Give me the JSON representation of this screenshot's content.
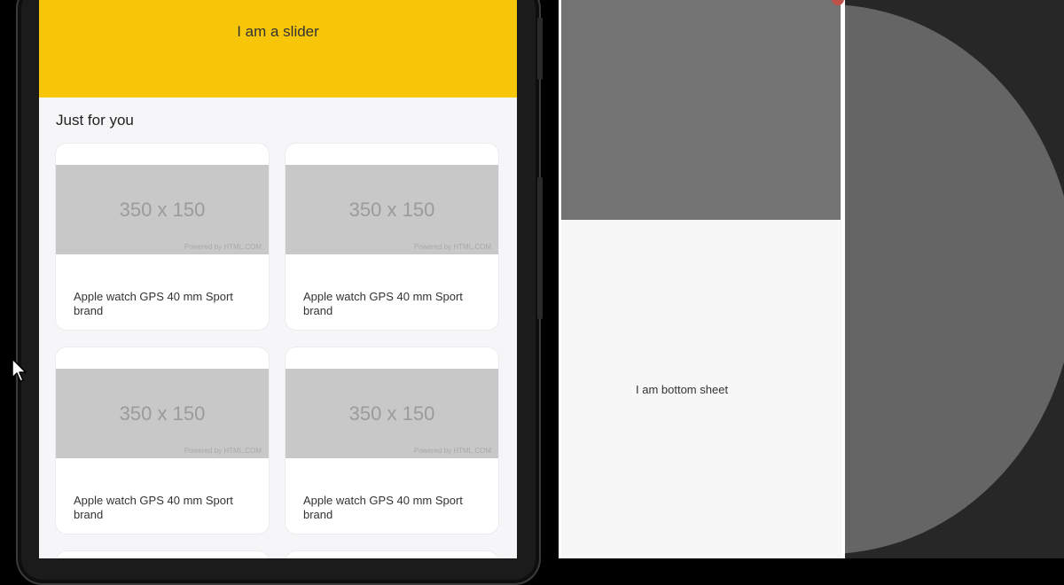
{
  "phone": {
    "slider_text": "I am a slider",
    "section_title": "Just for you",
    "cards": [
      {
        "image_text": "350 x 150",
        "powered": "Powered by HTML.COM",
        "title": "Apple watch GPS 40 mm Sport brand"
      },
      {
        "image_text": "350 x 150",
        "powered": "Powered by HTML.COM",
        "title": "Apple watch GPS 40 mm Sport brand"
      },
      {
        "image_text": "350 x 150",
        "powered": "Powered by HTML.COM",
        "title": "Apple watch GPS 40 mm Sport brand"
      },
      {
        "image_text": "350 x 150",
        "powered": "Powered by HTML.COM",
        "title": "Apple watch GPS 40 mm Sport brand"
      }
    ]
  },
  "bottom_sheet": {
    "text": "I am bottom sheet"
  },
  "colors": {
    "slider_bg": "#f7c608",
    "scrim": "#737373",
    "dark_bg": "#272727",
    "circle": "#656565"
  },
  "icons": {
    "cursor": "mouse-pointer-icon"
  }
}
